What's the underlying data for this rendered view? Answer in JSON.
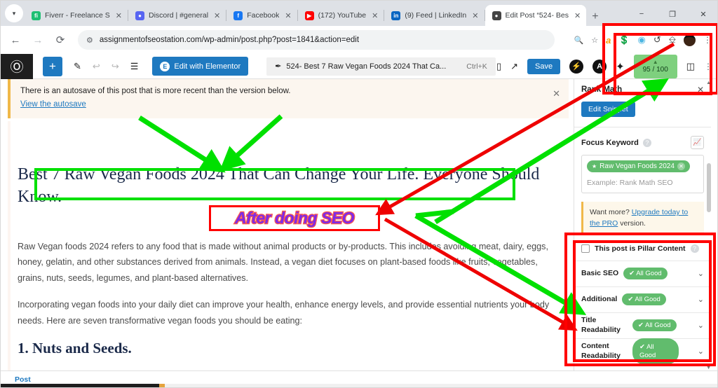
{
  "browser": {
    "tabs": [
      {
        "title": "Fiverr - Freelance S",
        "favicon": "fiverr-icon",
        "favicon_color": "#1dbf73",
        "glyph": "fi",
        "active": false
      },
      {
        "title": "Discord | #general",
        "favicon": "discord-icon",
        "favicon_color": "#5865f2",
        "glyph": "●",
        "active": false
      },
      {
        "title": "Facebook",
        "favicon": "facebook-icon",
        "favicon_color": "#1877f2",
        "glyph": "f",
        "active": false
      },
      {
        "title": "(172) YouTube",
        "favicon": "youtube-icon",
        "favicon_color": "#ff0000",
        "glyph": "▶",
        "active": false
      },
      {
        "title": "(9) Feed | LinkedIn",
        "favicon": "linkedin-icon",
        "favicon_color": "#0a66c2",
        "glyph": "in",
        "active": false
      },
      {
        "title": "Edit Post “524- Bes",
        "favicon": "globe-icon",
        "favicon_color": "#444444",
        "glyph": "●",
        "active": true
      }
    ],
    "tab_close_label": "✕",
    "new_tab_label": "+",
    "tab_list_icon": "chevron-down-icon",
    "window_buttons": [
      "−",
      "❐",
      "✕"
    ],
    "nav": {
      "back": "←",
      "forward": "→",
      "reload": "⟳"
    },
    "omnibox": {
      "url": "assignmentofseostation.com/wp-admin/post.php?post=1841&action=edit",
      "site_info_icon": "tune-icon",
      "zoom_icon": "search-icon",
      "bookmark_icon": "star-icon"
    },
    "extensions": [
      {
        "name": "amazon-extension-icon",
        "glyph": "a",
        "color": "#ff9900"
      },
      {
        "name": "honey-extension-icon",
        "glyph": "💲",
        "color": "#19a974"
      },
      {
        "name": "grammarly-extension-icon",
        "glyph": "●",
        "color": "#4db6e2"
      },
      {
        "name": "history-extension-icon",
        "glyph": "↺",
        "color": "#444444"
      },
      {
        "name": "downloads-icon",
        "glyph": "⬇",
        "color": "#444444"
      }
    ],
    "profile_icon": "avatar-icon",
    "menu_icon": "kebab-menu-icon"
  },
  "wp_toolbar": {
    "logo": "wordpress-logo",
    "add_block_label": "+",
    "tools": [
      {
        "name": "edit-tool-icon",
        "glyph": "✎"
      },
      {
        "name": "undo-icon",
        "glyph": "↩"
      },
      {
        "name": "redo-icon",
        "glyph": "↪"
      },
      {
        "name": "document-overview-icon",
        "glyph": "☰"
      }
    ],
    "elementor_label": "Edit with Elementor",
    "elementor_badge": "E",
    "doc_chip_title": "524- Best 7 Raw Vegan Foods 2024 That Ca...",
    "doc_chip_shortcut": "Ctrl+K",
    "doc_chip_icon": "feather-icon",
    "preview_icon": "desktop-icon",
    "view_icon": "external-link-icon",
    "save_label": "Save",
    "jetpack_icon": "jetpack-icon",
    "jetpack_glyph": "⚡",
    "rankmath_icon": "rankmath-icon",
    "rankmath_glyph": "Ⓐ",
    "ai_icon": "sparkle-icon",
    "ai_glyph": "✦",
    "score_icon": "seo-score-icon",
    "score_value": "95 / 100",
    "settings_panel_icon": "sidebar-toggle-icon",
    "more_menu_icon": "kebab-menu-icon"
  },
  "notice": {
    "message": "There is an autosave of this post that is more recent than the version below.",
    "link": "View the autosave",
    "close": "✕"
  },
  "post": {
    "title": "Best 7 Raw Vegan Foods 2024 That Can Change Your Life. Everyone Should Know.",
    "paragraphs": [
      "Raw Vegan foods 2024 refers to any food that is made without animal products or by-products. This includes avoiding meat, dairy, eggs, honey, gelatin, and other substances derived from animals. Instead, a vegan diet focuses on plant-based foods like fruits, vegetables, grains, nuts, seeds, legumes, and plant-based alternatives.",
      "Incorporating vegan foods into your daily diet can improve your health, enhance energy levels, and provide essential nutrients your body needs. Here are seven transformative vegan foods you should be eating:"
    ],
    "heading2": "1. Nuts and Seeds."
  },
  "sidebar": {
    "title": "Rank Math",
    "pin_icon": "pin-star-icon",
    "close_icon": "close-icon",
    "edit_snippet_label": "Edit Snippet",
    "focus_keyword": {
      "label": "Focus Keyword",
      "help_icon": "help-circle-icon",
      "trends_icon": "google-trends-icon",
      "keyword": "Raw Vegan Foods 2024",
      "keyword_star": "★",
      "keyword_remove": "✕",
      "placeholder": "Example: Rank Math SEO"
    },
    "pro_notice": {
      "prefix": "Want more?",
      "link": "Upgrade today to the PRO",
      "suffix": "version."
    },
    "pillar_label": "This post is Pillar Content",
    "pillar_help_icon": "help-circle-icon",
    "accordions": [
      {
        "name": "Basic SEO",
        "status": "✔ All Good",
        "chevron": "⌄"
      },
      {
        "name": "Additional",
        "status": "✔ All Good",
        "chevron": "⌄"
      },
      {
        "name": "Title Readability",
        "status": "✔ All Good",
        "chevron": "⌄"
      },
      {
        "name": "Content Readability",
        "status": "✔ All Good",
        "chevron": "⌄"
      }
    ]
  },
  "footer": {
    "breadcrumb": "Post"
  },
  "annotations": {
    "stamp_text": "After doing SEO",
    "stamp_color": "#7d2ae8",
    "stamp_outline_color": "#ff5a4d",
    "box_color": "#ff0000",
    "arrow_green": "#00e000",
    "arrow_red": "#ee0000"
  }
}
